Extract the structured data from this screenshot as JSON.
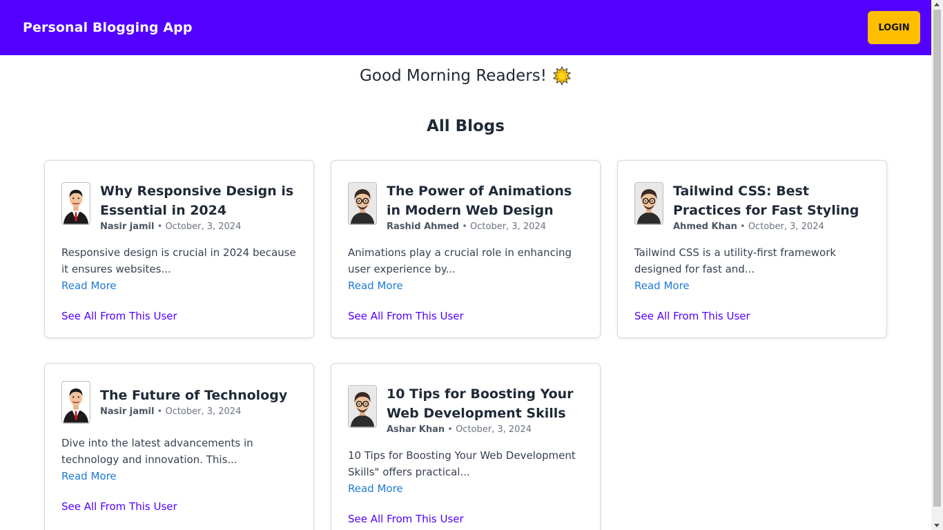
{
  "app": {
    "title": "Personal Blogging App",
    "login_label": "LOGIN"
  },
  "greeting": {
    "text": "Good Morning Readers!",
    "icon": "sun-icon"
  },
  "section_title": "All Blogs",
  "colors": {
    "nav_bg": "#5200ff",
    "login_bg": "#ffbf00",
    "read_more": "#1e7ad6",
    "see_all": "#5200ff"
  },
  "posts": [
    {
      "title": "Why Responsive Design is Essential in 2024",
      "author": "Nasir jamil",
      "date": "October, 3, 2024",
      "excerpt": "Responsive design is crucial in 2024 because it ensures websites...",
      "read_more": "Read More",
      "see_all": "See All From This User",
      "avatar": "businessman-avatar"
    },
    {
      "title": "The Power of Animations in Modern Web Design",
      "author": "Rashid Ahmed",
      "date": "October, 3, 2024",
      "excerpt": "Animations play a crucial role in enhancing user experience by...",
      "read_more": "Read More",
      "see_all": "See All From This User",
      "avatar": "glasses-man-avatar"
    },
    {
      "title": "Tailwind CSS: Best Practices for Fast Styling",
      "author": "Ahmed Khan",
      "date": "October, 3, 2024",
      "excerpt": "Tailwind CSS is a utility-first framework designed for fast and...",
      "read_more": "Read More",
      "see_all": "See All From This User",
      "avatar": "glasses-man-avatar"
    },
    {
      "title": "The Future of Technology",
      "author": "Nasir jamil",
      "date": "October, 3, 2024",
      "excerpt": "Dive into the latest advancements in technology and innovation. This...",
      "read_more": "Read More",
      "see_all": "See All From This User",
      "avatar": "businessman-avatar"
    },
    {
      "title": "10 Tips for Boosting Your Web Development Skills",
      "author": "Ashar Khan",
      "date": "October, 3, 2024",
      "excerpt": "10 Tips for Boosting Your Web Development Skills\" offers practical...",
      "read_more": "Read More",
      "see_all": "See All From This User",
      "avatar": "glasses-man-avatar"
    }
  ]
}
